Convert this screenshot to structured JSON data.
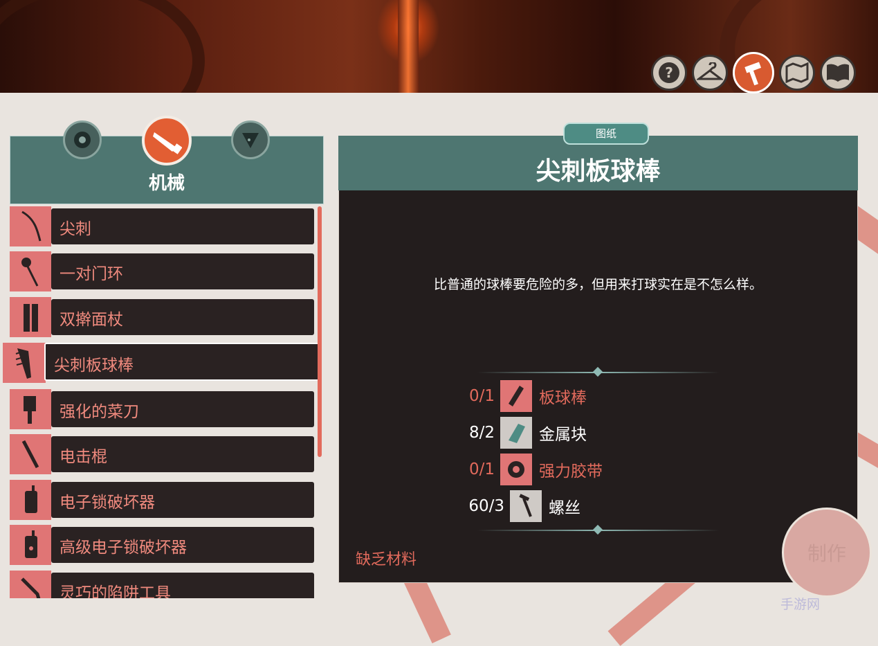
{
  "top_nav": {
    "buttons": [
      {
        "icon": "question-icon"
      },
      {
        "icon": "hanger-icon"
      },
      {
        "icon": "hammer-icon",
        "active": true
      },
      {
        "icon": "map-icon"
      },
      {
        "icon": "book-icon"
      }
    ]
  },
  "category": {
    "title": "机械",
    "tabs": [
      {
        "icon": "tape-icon"
      },
      {
        "icon": "saw-icon",
        "active": true
      },
      {
        "icon": "flask-icon"
      }
    ]
  },
  "recipes": [
    {
      "label": "尖刺"
    },
    {
      "label": "一对门环"
    },
    {
      "label": "双擀面杖"
    },
    {
      "label": "尖刺板球棒",
      "selected": true
    },
    {
      "label": "强化的菜刀"
    },
    {
      "label": "电击棍"
    },
    {
      "label": "电子锁破坏器"
    },
    {
      "label": "高级电子锁破坏器"
    },
    {
      "label": "灵巧的陷阱工具"
    }
  ],
  "detail": {
    "tag": "图纸",
    "title": "尖刺板球棒",
    "description": "比普通的球棒要危险的多，但用来打球实在是不怎么样。",
    "materials": [
      {
        "qty": "0/1",
        "name": "板球棒",
        "sufficient": false
      },
      {
        "qty": "8/2",
        "name": "金属块",
        "sufficient": true
      },
      {
        "qty": "0/1",
        "name": "强力胶带",
        "sufficient": false
      },
      {
        "qty": "60/3",
        "name": "螺丝",
        "sufficient": true
      }
    ],
    "status": "缺乏材料",
    "craft_label": "制作"
  },
  "watermark": "手游网",
  "colors": {
    "teal": "#4e7671",
    "accent_red": "#e26a5c",
    "panel_dark": "#231d1d"
  }
}
